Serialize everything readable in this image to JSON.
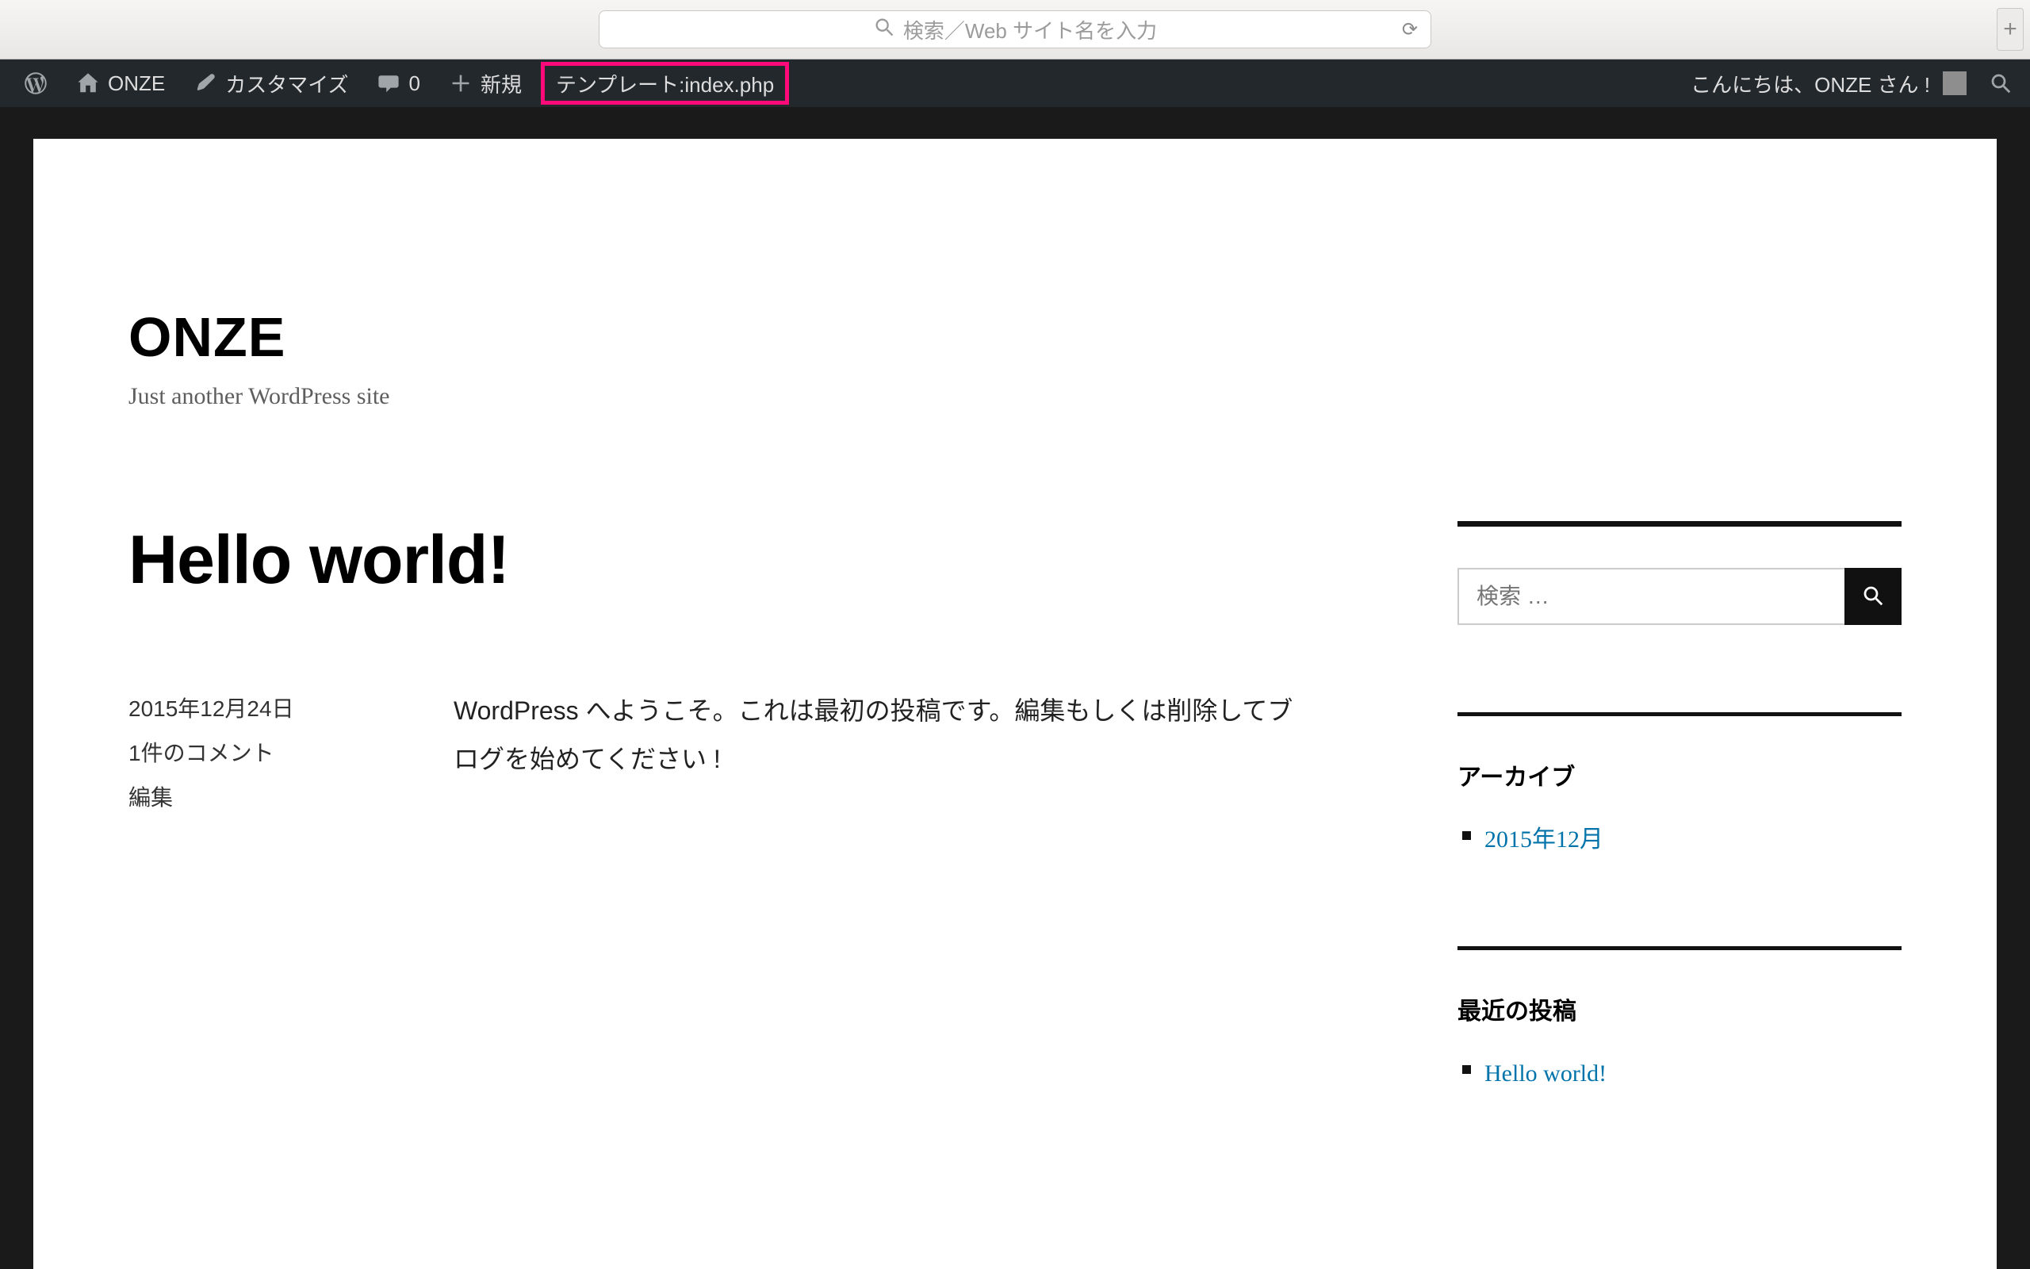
{
  "browser": {
    "address_placeholder": "検索／Web サイト名を入力"
  },
  "adminbar": {
    "site_name": "ONZE",
    "customize": "カスタマイズ",
    "comments_count": "0",
    "new_label": "新規",
    "template_label": "テンプレート:index.php",
    "greeting": "こんにちは、ONZE さん !"
  },
  "site": {
    "title": "ONZE",
    "tagline": "Just another WordPress site"
  },
  "post": {
    "title": "Hello world!",
    "date": "2015年12月24日",
    "comments_link": "1件のコメント",
    "edit_link": "編集",
    "content": "WordPress へようこそ。これは最初の投稿です。編集もしくは削除してブログを始めてください !"
  },
  "sidebar": {
    "search_placeholder": "検索 …",
    "archive_title": "アーカイブ",
    "archive_items": [
      "2015年12月"
    ],
    "recent_title": "最近の投稿",
    "recent_items": [
      "Hello world!"
    ]
  }
}
